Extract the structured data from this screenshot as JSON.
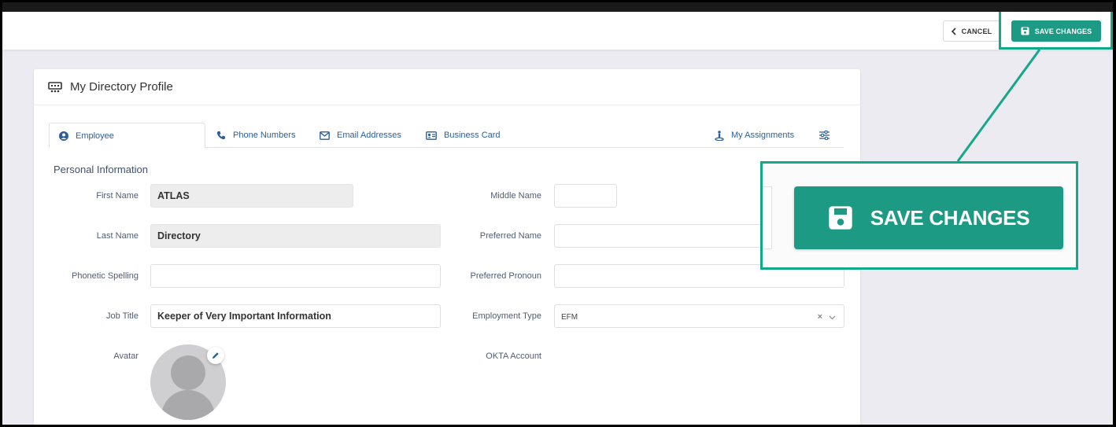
{
  "toolbar": {
    "cancel_label": "CANCEL",
    "save_label": "SAVE CHANGES"
  },
  "card": {
    "title": "My Directory Profile"
  },
  "tabs": [
    {
      "label": "Employee",
      "icon": "user-circle-icon",
      "active": true
    },
    {
      "label": "Phone Numbers",
      "icon": "phone-icon",
      "active": false
    },
    {
      "label": "Email Addresses",
      "icon": "envelope-icon",
      "active": false
    },
    {
      "label": "Business Card",
      "icon": "id-card-icon",
      "active": false
    },
    {
      "label": "My Assignments",
      "icon": "person-pin-icon",
      "active": false
    }
  ],
  "section": {
    "title": "Personal Information"
  },
  "fields": {
    "first_name": {
      "label": "First Name",
      "value": "ATLAS"
    },
    "middle_name": {
      "label": "Middle Name",
      "value": ""
    },
    "last_name": {
      "label": "Last Name",
      "value": "Directory"
    },
    "preferred_name": {
      "label": "Preferred Name",
      "value": ""
    },
    "phonetic_spelling": {
      "label": "Phonetic Spelling",
      "value": ""
    },
    "preferred_pronoun": {
      "label": "Preferred Pronoun",
      "value": ""
    },
    "job_title": {
      "label": "Job Title",
      "value": "Keeper of Very Important Information"
    },
    "employment_type": {
      "label": "Employment Type",
      "value": "EFM"
    },
    "avatar": {
      "label": "Avatar"
    },
    "okta_account": {
      "label": "OKTA Account"
    }
  },
  "zoom_callout": {
    "label": "SAVE CHANGES"
  },
  "colors": {
    "accent": "#1d9a84",
    "highlight": "#14a88a",
    "tab_text": "#2d5f9a"
  }
}
